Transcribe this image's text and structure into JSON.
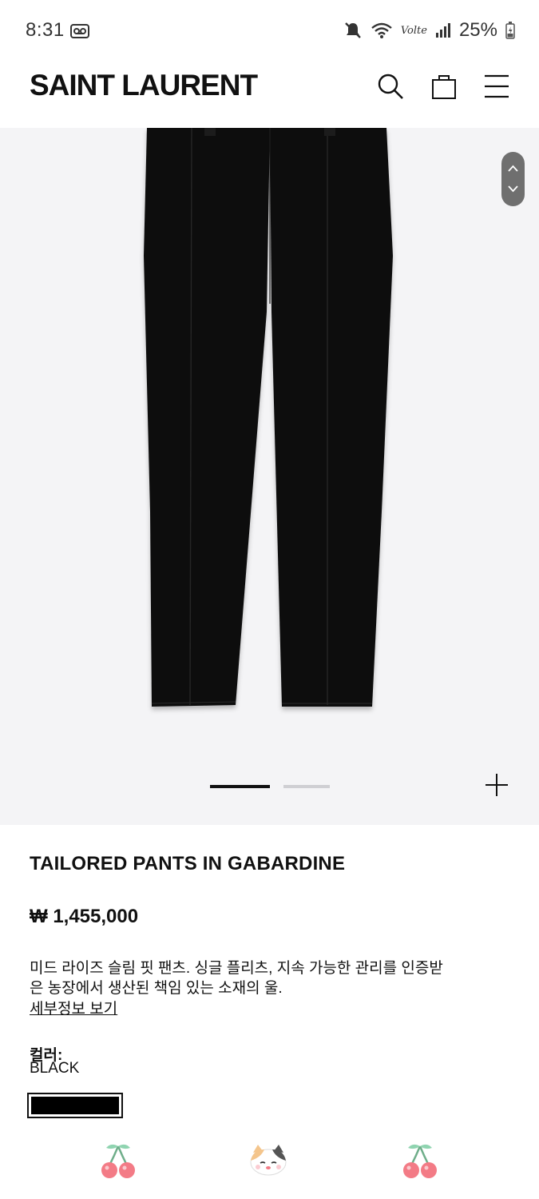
{
  "status_bar": {
    "time": "8:31",
    "volte": "Volte",
    "battery": "25%",
    "icons": [
      "voicemail-icon",
      "mute-icon",
      "wifi-icon",
      "signal-icon",
      "battery-icon"
    ]
  },
  "header": {
    "brand": "SAINT LAURENT",
    "icons": [
      "search-icon",
      "shopping-bag-icon",
      "menu-icon"
    ]
  },
  "gallery": {
    "image_alt": "tailored-black-pants",
    "background": "#f4f4f6",
    "pager_count": 2,
    "pager_active": 1,
    "zoom_icon": "plus-icon"
  },
  "product": {
    "title": "TAILORED PANTS IN GABARDINE",
    "price": "₩ 1,455,000",
    "description": "미드 라이즈 슬림 핏 팬츠. 싱글 플리츠, 지속 가능한 관리를 인증받은 농장에서 생산된 책임 있는 소재의 울.",
    "details_link": "세부정보 보기",
    "color_label": "컬러:",
    "color_value": "BLACK",
    "swatch_color": "#000000"
  },
  "bottom_stickers": [
    "cherry-icon",
    "cat-icon",
    "cherry-icon"
  ]
}
